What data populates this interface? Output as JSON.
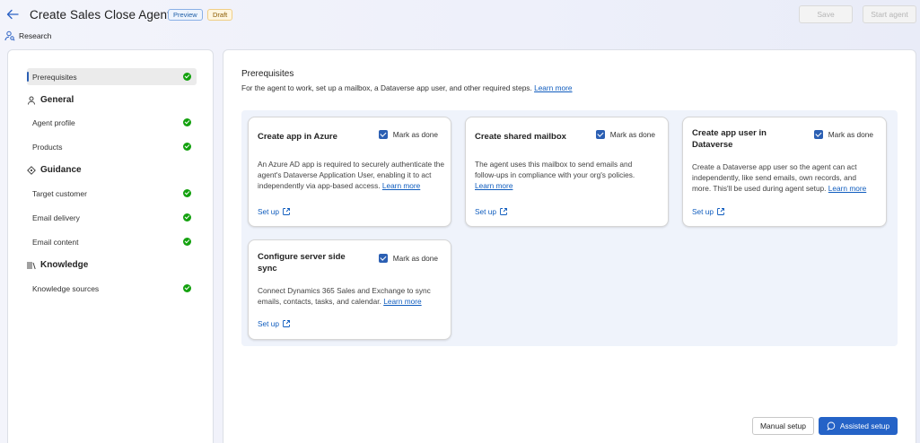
{
  "header": {
    "title": "Create Sales Close Agent",
    "badge_preview": "Preview",
    "badge_draft": "Draft",
    "save_label": "Save",
    "start_label": "Start agent",
    "research_label": "Research"
  },
  "sidebar": {
    "prerequisites": "Prerequisites",
    "general_heading": "General",
    "agent_profile": "Agent profile",
    "products": "Products",
    "guidance_heading": "Guidance",
    "target_customer": "Target customer",
    "email_delivery": "Email delivery",
    "email_content": "Email content",
    "knowledge_heading": "Knowledge",
    "knowledge_sources": "Knowledge sources"
  },
  "main": {
    "title": "Prerequisites",
    "desc": "For the agent to work, set up a mailbox, a Dataverse app user, and other required steps.",
    "learn_more": "Learn more",
    "mark_as_done": "Mark as done",
    "set_up": "Set up",
    "cards": [
      {
        "title": "Create app in Azure",
        "body": "An Azure AD app is required to securely authenticate the agent's Dataverse Application User, enabling it to act independently via app-based access.",
        "link": "Learn more"
      },
      {
        "title": "Create shared mailbox",
        "body": "The agent uses this mailbox to send emails and follow-ups in compliance with your org's policies.",
        "link": "Learn more"
      },
      {
        "title": "Create app user in Dataverse",
        "body": "Create a Dataverse app user so the agent can act independently, like send emails, own records, and more. This'll be used during agent setup.",
        "link": "Learn more"
      },
      {
        "title": "Configure server side sync",
        "body": "Connect Dynamics 365 Sales and Exchange to sync emails, contacts, tasks, and calendar.",
        "link": "Learn more"
      }
    ]
  },
  "footer": {
    "manual_setup": "Manual setup",
    "assisted_setup": "Assisted setup"
  }
}
